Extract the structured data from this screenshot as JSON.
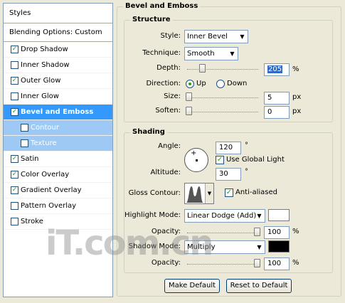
{
  "styles_panel": {
    "header": "Styles",
    "blending": "Blending Options: Custom",
    "items": [
      {
        "label": "Drop Shadow",
        "checked": true
      },
      {
        "label": "Inner Shadow",
        "checked": false
      },
      {
        "label": "Outer Glow",
        "checked": true
      },
      {
        "label": "Inner Glow",
        "checked": false
      },
      {
        "label": "Bevel and Emboss",
        "checked": true,
        "selected": true
      },
      {
        "label": "Contour",
        "checked": false,
        "sub": true
      },
      {
        "label": "Texture",
        "checked": false,
        "sub": true
      },
      {
        "label": "Satin",
        "checked": true
      },
      {
        "label": "Color Overlay",
        "checked": true
      },
      {
        "label": "Gradient Overlay",
        "checked": true
      },
      {
        "label": "Pattern Overlay",
        "checked": false
      },
      {
        "label": "Stroke",
        "checked": false
      }
    ]
  },
  "bevel": {
    "title": "Bevel and Emboss",
    "structure": {
      "title": "Structure",
      "style_label": "Style:",
      "style_value": "Inner Bevel",
      "technique_label": "Technique:",
      "technique_value": "Smooth",
      "depth_label": "Depth:",
      "depth_value": "205",
      "depth_unit": "%",
      "direction_label": "Direction:",
      "dir_up": "Up",
      "dir_down": "Down",
      "direction_selected": "Up",
      "size_label": "Size:",
      "size_value": "5",
      "size_unit": "px",
      "soften_label": "Soften:",
      "soften_value": "0",
      "soften_unit": "px"
    },
    "shading": {
      "title": "Shading",
      "angle_label": "Angle:",
      "angle_value": "120",
      "angle_unit": "°",
      "global_light_label": "Use Global Light",
      "global_light_checked": true,
      "altitude_label": "Altitude:",
      "altitude_value": "30",
      "altitude_unit": "°",
      "gloss_label": "Gloss Contour:",
      "anti_aliased_label": "Anti-aliased",
      "anti_aliased_checked": true,
      "highlight_mode_label": "Highlight Mode:",
      "highlight_mode_value": "Linear Dodge (Add)",
      "highlight_color": "#ffffff",
      "highlight_opacity_label": "Opacity:",
      "highlight_opacity_value": "100",
      "highlight_opacity_unit": "%",
      "shadow_mode_label": "Shadow Mode:",
      "shadow_mode_value": "Multiply",
      "shadow_color": "#000000",
      "shadow_opacity_label": "Opacity:",
      "shadow_opacity_value": "100",
      "shadow_opacity_unit": "%"
    },
    "make_default": "Make Default",
    "reset_default": "Reset to Default"
  },
  "watermark": "iT.com.cn",
  "colors": {
    "panel_bg": "#ece9d8",
    "selection": "#3399ff",
    "sub_selection": "#9ec9f5",
    "field_border": "#7f9db9"
  }
}
